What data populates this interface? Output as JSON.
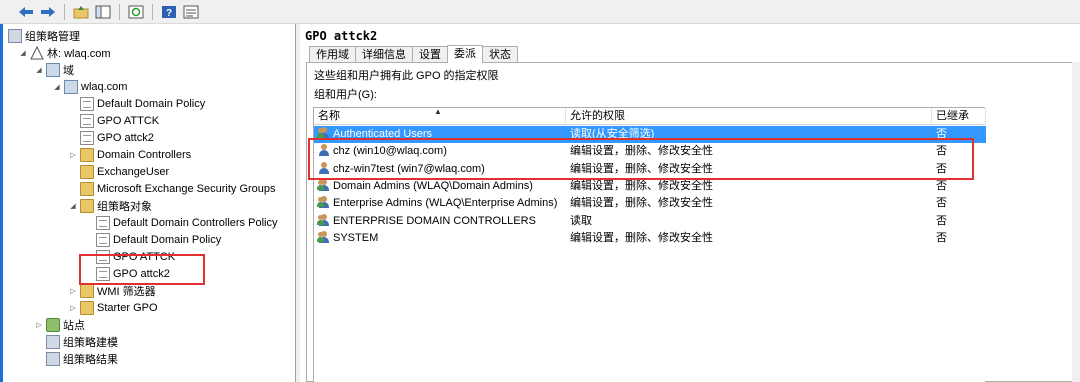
{
  "toolbar": {
    "buttons": [
      {
        "icon": "back-arrow-icon"
      },
      {
        "icon": "forward-arrow-icon"
      },
      {
        "icon": "up-folder-icon"
      },
      {
        "icon": "show-hide-tree-icon"
      },
      {
        "icon": "refresh-icon"
      },
      {
        "icon": "help-icon"
      },
      {
        "icon": "properties-icon"
      }
    ]
  },
  "tree": {
    "root": "组策略管理",
    "forest": "林: wlaq.com",
    "domains": "域",
    "domain": "wlaq.com",
    "items": [
      "Default Domain Policy",
      "GPO ATTCK",
      "GPO attck2",
      "Domain Controllers",
      "ExchangeUser",
      "Microsoft Exchange Security Groups",
      "组策略对象"
    ],
    "gpo_objects": [
      "Default Domain Controllers Policy",
      "Default Domain Policy",
      "GPO ATTCK",
      "GPO attck2"
    ],
    "wmi": "WMI 筛选器",
    "starter": "Starter GPO",
    "sites": "站点",
    "modeling": "组策略建模",
    "results": "组策略结果"
  },
  "detail": {
    "title": "GPO attck2",
    "tabs": [
      "作用域",
      "详细信息",
      "设置",
      "委派",
      "状态"
    ],
    "active_tab": "委派",
    "description": "这些组和用户拥有此 GPO 的指定权限",
    "group_label": "组和用户(G):",
    "columns": [
      "名称",
      "允许的权限",
      "已继承"
    ],
    "rows": [
      {
        "name": "Authenticated Users",
        "perm": "读取(从安全筛选)",
        "inherited": "否",
        "kind": "group"
      },
      {
        "name": "chz (win10@wlaq.com)",
        "perm": "编辑设置，删除、修改安全性",
        "inherited": "否",
        "kind": "user"
      },
      {
        "name": "chz-win7test (win7@wlaq.com)",
        "perm": "编辑设置，删除、修改安全性",
        "inherited": "否",
        "kind": "user"
      },
      {
        "name": "Domain Admins (WLAQ\\Domain Admins)",
        "perm": "编辑设置，删除、修改安全性",
        "inherited": "否",
        "kind": "group"
      },
      {
        "name": "Enterprise Admins (WLAQ\\Enterprise Admins)",
        "perm": "编辑设置，删除、修改安全性",
        "inherited": "否",
        "kind": "group"
      },
      {
        "name": "ENTERPRISE DOMAIN CONTROLLERS",
        "perm": "读取",
        "inherited": "否",
        "kind": "group"
      },
      {
        "name": "SYSTEM",
        "perm": "编辑设置，删除、修改安全性",
        "inherited": "否",
        "kind": "group"
      }
    ]
  },
  "colors": {
    "selection": "#3399ff",
    "annotation": "#e03030"
  }
}
